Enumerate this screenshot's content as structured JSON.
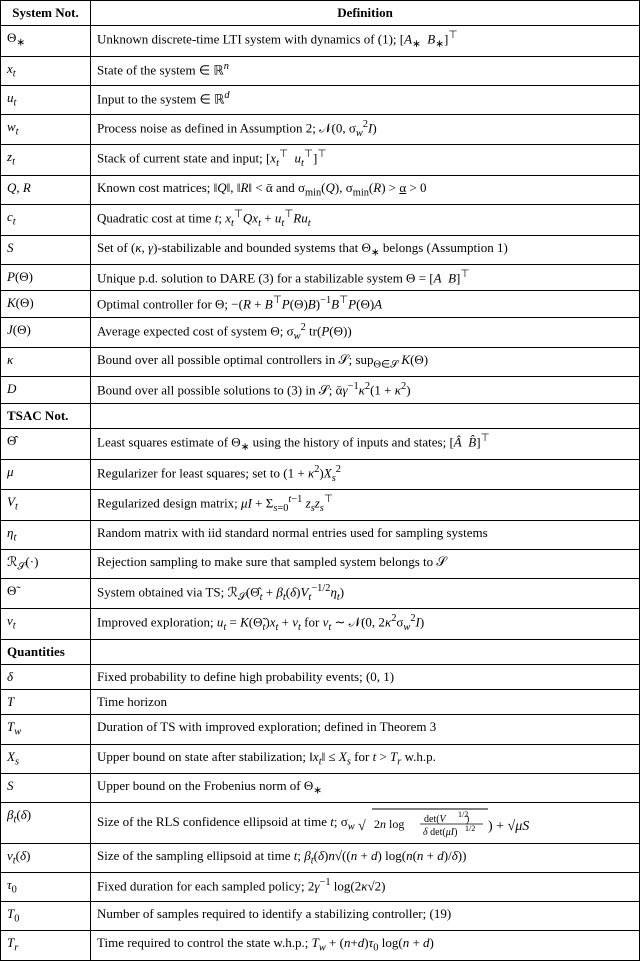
{
  "table": {
    "headers": [
      "System Not.",
      "Definition"
    ],
    "sections": [
      {
        "type": "header",
        "cols": [
          "System Not.",
          "Definition"
        ]
      },
      {
        "type": "rows",
        "rows": [
          {
            "notation": "Θ<sub>∗</sub>",
            "definition": "Unknown discrete-time LTI system with dynamics of (1); [<i>A</i><sub>∗</sub> &nbsp;<i>B</i><sub>∗</sub>]<sup>⊤</sup>"
          },
          {
            "notation": "<i>x</i><sub><i>t</i></sub>",
            "definition": "State of the system ∈ ℝ<sup><i>n</i></sup>"
          },
          {
            "notation": "<i>u</i><sub><i>t</i></sub>",
            "definition": "Input to the system ∈ ℝ<sup><i>d</i></sup>"
          },
          {
            "notation": "<i>w</i><sub><i>t</i></sub>",
            "definition": "Process noise as defined in Assumption 2; 𝒩(0, σ<sub><i>w</i></sub><sup>2</sup><i>I</i>)"
          },
          {
            "notation": "<i>z</i><sub><i>t</i></sub>",
            "definition": "Stack of current state and input; [<i>x</i><sub><i>t</i></sub><sup>⊤</sup> &nbsp;<i>u</i><sub><i>t</i></sub><sup>⊤</sup>]<sup>⊤</sup>"
          },
          {
            "notation": "<i>Q</i>, <i>R</i>",
            "definition": "Known cost matrices; ‖<i>Q</i>‖, ‖<i>R</i>‖ &lt; ᾱ and σ<sub>min</sub>(<i>Q</i>), σ<sub>min</sub>(<i>R</i>) &gt; <u>α</u> &gt; 0"
          },
          {
            "notation": "<i>c</i><sub><i>t</i></sub>",
            "definition": "Quadratic cost at time <i>t</i>; <i>x</i><sub><i>t</i></sub><sup>⊤</sup><i>Qx</i><sub><i>t</i></sub> + <i>u</i><sub><i>t</i></sub><sup>⊤</sup><i>Ru</i><sub><i>t</i></sub>"
          },
          {
            "notation": "<i>S</i>",
            "definition": "Set of (<i>κ</i>, <i>γ</i>)-stabilizable and bounded systems that Θ<sub>∗</sub> belongs (Assumption 1)"
          },
          {
            "notation": "<i>P</i>(Θ)",
            "definition": "Unique p.d. solution to DARE (3) for a stabilizable system Θ = [<i>A</i> &nbsp;<i>B</i>]<sup>⊤</sup>"
          },
          {
            "notation": "<i>K</i>(Θ)",
            "definition": "Optimal controller for Θ; −(<i>R</i> + <i>B</i><sup>⊤</sup><i>P</i>(Θ)<i>B</i>)<sup>−1</sup><i>B</i><sup>⊤</sup><i>P</i>(Θ)<i>A</i>"
          },
          {
            "notation": "<i>J</i>(Θ)",
            "definition": "Average expected cost of system Θ; σ<sub><i>w</i></sub><sup>2</sup> tr(<i>P</i>(Θ))"
          },
          {
            "notation": "<i>κ</i>",
            "definition": "Bound over all possible optimal controllers in 𝒮; sup<sub>Θ∈𝒮</sub> <i>K</i>(Θ)"
          },
          {
            "notation": "<i>D</i>",
            "definition": "Bound over all possible solutions to (3) in 𝒮; ᾱ<i>γ</i><sup>−1</sup><i>κ</i><sup>2</sup>(1 + <i>κ</i><sup>2</sup>)"
          }
        ]
      },
      {
        "type": "section-header",
        "label": "TSAC Not."
      },
      {
        "type": "rows",
        "rows": [
          {
            "notation": "Θ̂",
            "definition": "Least squares estimate of Θ<sub>∗</sub> using the history of inputs and states; [<i>Â</i> &nbsp;<i>B̂</i>]<sup>⊤</sup>"
          },
          {
            "notation": "<i>μ</i>",
            "definition": "Regularizer for least squares; set to (1 + <i>κ</i><sup>2</sup>)<i>X</i><sub><i>s</i></sub><sup>2</sup>"
          },
          {
            "notation": "<i>V</i><sub><i>t</i></sub>",
            "definition": "Regularized design matrix; <i>μI</i> + Σ<sub><i>s</i>=0</sub><sup><i>t</i>−1</sup> <i>z</i><sub><i>s</i></sub><i>z</i><sub><i>s</i></sub><sup>⊤</sup>"
          },
          {
            "notation": "<i>η</i><sub><i>t</i></sub>",
            "definition": "Random matrix with iid standard normal entries used for sampling systems"
          },
          {
            "notation": "ℛ<sub>𝒮</sub>(·)",
            "definition": "Rejection sampling to make sure that sampled system belongs to 𝒮"
          },
          {
            "notation": "Θ̃",
            "definition": "System obtained via TS; ℛ<sub>𝒮</sub>(Θ̂<sub><i>t</i></sub> + <i>β</i><sub><i>t</i></sub>(<i>δ</i>)<i>V</i><sub><i>t</i></sub><sup>−1/2</sup><i>η</i><sub><i>t</i></sub>)"
          },
          {
            "notation": "<i>ν</i><sub><i>t</i></sub>",
            "definition": "Improved exploration; <i>u</i><sub><i>t</i></sub> = <i>K</i>(Θ̃<sub><i>t</i></sub>)<i>x</i><sub><i>t</i></sub> + <i>ν</i><sub><i>t</i></sub> for <i>ν</i><sub><i>t</i></sub> ∼ 𝒩(0, 2<i>κ</i><sup>2</sup>σ<sub><i>w</i></sub><sup>2</sup><i>I</i>)"
          }
        ]
      },
      {
        "type": "section-header",
        "label": "Quantities"
      },
      {
        "type": "rows",
        "rows": [
          {
            "notation": "<i>δ</i>",
            "definition": "Fixed probability to define high probability events; (0, 1)"
          },
          {
            "notation": "<i>T</i>",
            "definition": "Time horizon"
          },
          {
            "notation": "<i>T</i><sub><i>w</i></sub>",
            "definition": "Duration of TS with improved exploration; defined in Theorem 3"
          },
          {
            "notation": "<i>X</i><sub><i>s</i></sub>",
            "definition": "Upper bound on state after stabilization; ‖<i>x</i><sub><i>t</i></sub>‖ ≤ <i>X</i><sub><i>s</i></sub> for <i>t</i> &gt; <i>T</i><sub><i>r</i></sub> w.h.p."
          },
          {
            "notation": "<i>S</i>",
            "definition": "Upper bound on the Frobenius norm of Θ<sub>∗</sub>"
          },
          {
            "notation": "<i>β</i><sub><i>t</i></sub>(<i>δ</i>)",
            "definition": "Size of the RLS confidence ellipsoid at time <i>t</i>; σ<sub><i>w</i></sub>√(2<i>n</i> log(det(<i>V</i><sub><i>t</i></sub>)<sup>1/2</sup> / (δ det(μI)<sup>1/2</sup>))) + √μ<i>S</i>"
          },
          {
            "notation": "<i>v</i><sub><i>t</i></sub>(<i>δ</i>)",
            "definition": "Size of the sampling ellipsoid at time <i>t</i>; <i>β</i><sub><i>t</i></sub>(<i>δ</i>)<i>n</i>√((<i>n</i> + <i>d</i>) log(<i>n</i>(<i>n</i> + <i>d</i>)/<i>δ</i>))"
          },
          {
            "notation": "<i>τ</i><sub>0</sub>",
            "definition": "Fixed duration for each sampled policy; 2<i>γ</i><sup>−1</sup> log(2<i>κ</i>√2)"
          },
          {
            "notation": "<i>T</i><sub>0</sub>",
            "definition": "Number of samples required to identify a stabilizing controller; (19)"
          },
          {
            "notation": "<i>T</i><sub><i>r</i></sub>",
            "definition": "Time required to control the state w.h.p.; <i>T</i><sub><i>w</i></sub> + (<i>n</i>+<i>d</i>)<i>τ</i><sub>0</sub> log(<i>n</i> + <i>d</i>)"
          }
        ]
      }
    ]
  }
}
